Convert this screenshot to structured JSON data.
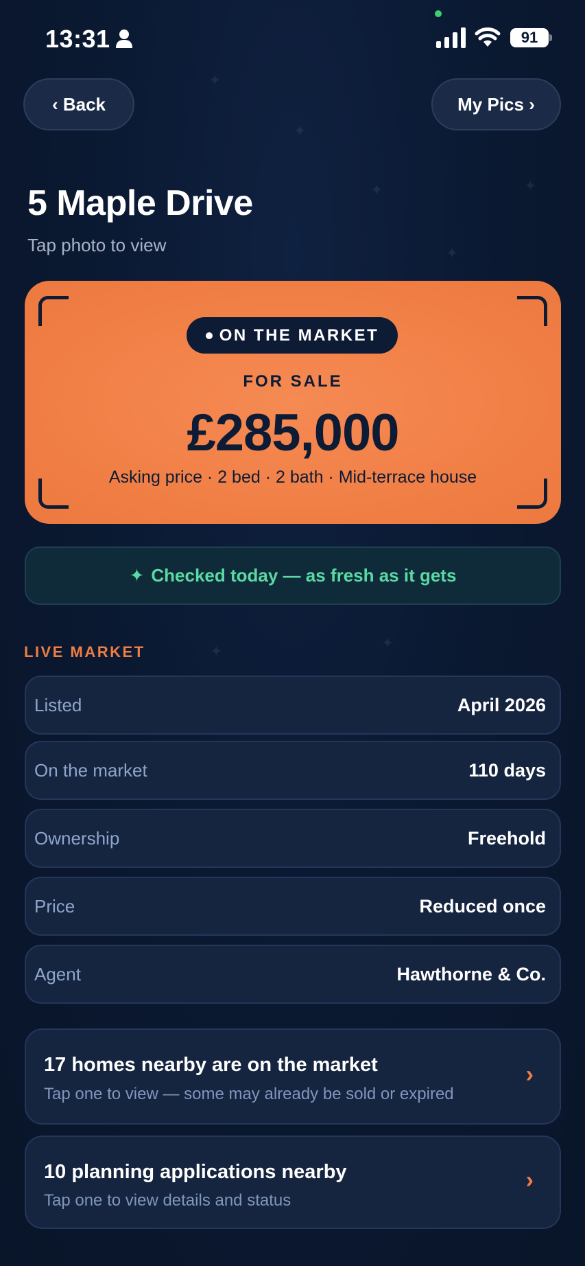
{
  "status_bar": {
    "time": "13:31",
    "battery": "91"
  },
  "nav": {
    "back_label": "‹ Back",
    "my_pics_label": "My Pics ›"
  },
  "header": {
    "title": "5 Maple Drive",
    "subtitle": "Tap photo to view"
  },
  "hero": {
    "badge": "ON THE MARKET",
    "status": "FOR SALE",
    "price": "£285,000",
    "details": "Asking price · 2 bed · 2 bath · Mid-terrace house",
    "color": "#f07e44"
  },
  "freshness": {
    "icon": "sparkle-icon",
    "text": "Checked today — as fresh as it gets",
    "color": "#5ad9a2"
  },
  "live_market": {
    "section_label": "LIVE MARKET",
    "rows": [
      {
        "label": "Listed",
        "value": "April 2026"
      },
      {
        "label": "On the market",
        "value": "110 days"
      },
      {
        "label": "Ownership",
        "value": "Freehold"
      },
      {
        "label": "Price",
        "value": "Reduced once"
      },
      {
        "label": "Agent",
        "value": "Hawthorne & Co."
      }
    ]
  },
  "nearby": [
    {
      "title": "17 homes nearby are on the market",
      "subtitle": "Tap one to view — some may already be sold or expired"
    },
    {
      "title": "10 planning applications nearby",
      "subtitle": "Tap one to view details and status"
    }
  ],
  "colors": {
    "background": "#0b1a33",
    "accent": "#f07e44",
    "card": "#15243f"
  }
}
